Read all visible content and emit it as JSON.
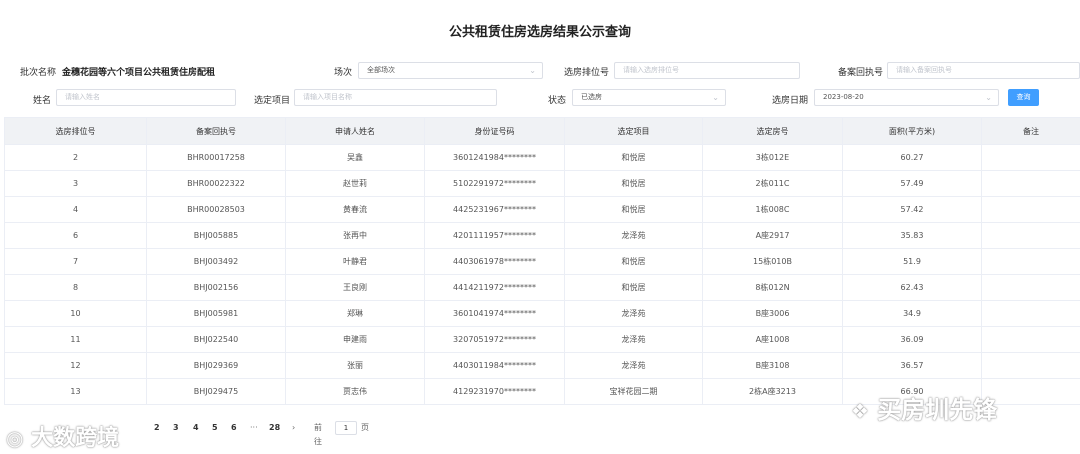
{
  "page": {
    "title": "公共租赁住房选房结果公示查询"
  },
  "filters": {
    "batch_label": "批次名称",
    "batch_value": "金穗花园等六个项目公共租赁住房配租",
    "session_label": "场次",
    "session_value": "全部场次",
    "rank_label": "选房排位号",
    "rank_placeholder": "请输入选房排位号",
    "receipt_label": "备案回执号",
    "receipt_placeholder": "请输入备案回执号",
    "name_label": "姓名",
    "name_placeholder": "请输入姓名",
    "project_label": "选定项目",
    "project_placeholder": "请输入项目名称",
    "status_label": "状态",
    "status_value": "已选房",
    "date_label": "选房日期",
    "date_value": "2023-08-20",
    "query_button": "查询"
  },
  "table": {
    "headers": [
      "选房排位号",
      "备案回执号",
      "申请人姓名",
      "身份证号码",
      "选定项目",
      "选定房号",
      "面积(平方米)",
      "备注"
    ],
    "rows": [
      [
        "2",
        "BHR00017258",
        "吴鑫",
        "3601241984********",
        "和悦居",
        "3栋012E",
        "60.27",
        ""
      ],
      [
        "3",
        "BHR00022322",
        "赵世莉",
        "5102291972********",
        "和悦居",
        "2栋011C",
        "57.49",
        ""
      ],
      [
        "4",
        "BHR00028503",
        "黄春流",
        "4425231967********",
        "和悦居",
        "1栋008C",
        "57.42",
        ""
      ],
      [
        "6",
        "BHJ005885",
        "张再中",
        "4201111957********",
        "龙泽苑",
        "A座2917",
        "35.83",
        ""
      ],
      [
        "7",
        "BHJ003492",
        "叶静君",
        "4403061978********",
        "和悦居",
        "15栋010B",
        "51.9",
        ""
      ],
      [
        "8",
        "BHJ002156",
        "王良刚",
        "4414211972********",
        "和悦居",
        "8栋012N",
        "62.43",
        ""
      ],
      [
        "10",
        "BHJ005981",
        "郑琳",
        "3601041974********",
        "龙泽苑",
        "B座3006",
        "34.9",
        ""
      ],
      [
        "11",
        "BHJ022540",
        "申建雨",
        "3207051972********",
        "龙泽苑",
        "A座1008",
        "36.09",
        ""
      ],
      [
        "12",
        "BHJ029369",
        "张丽",
        "4403011984********",
        "龙泽苑",
        "B座3108",
        "36.57",
        ""
      ],
      [
        "13",
        "BHJ029475",
        "贾志伟",
        "4129231970********",
        "宝祥花园二期",
        "2栋A座3213",
        "66.90",
        ""
      ]
    ]
  },
  "pagination": {
    "pages": [
      "2",
      "3",
      "4",
      "5",
      "6"
    ],
    "ellipsis": "···",
    "last": "28",
    "next": "›",
    "goto_label": "前往",
    "goto_value": "1",
    "page_unit": "页"
  },
  "watermarks": {
    "left": "大数跨境",
    "right": "买房圳先锋"
  }
}
